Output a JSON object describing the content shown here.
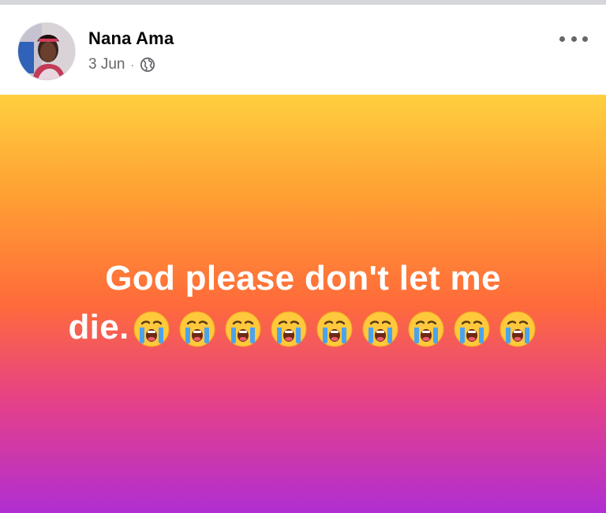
{
  "post": {
    "author": "Nana Ama",
    "date": "3 Jun",
    "separator": "·",
    "audience_icon": "globe-icon",
    "more_icon": "more-options-icon",
    "status_line_1": "God please don't let me",
    "status_line_2_text": "die.",
    "status_emojis": [
      "loudly-crying-face",
      "loudly-crying-face",
      "loudly-crying-face",
      "loudly-crying-face",
      "loudly-crying-face",
      "loudly-crying-face",
      "loudly-crying-face",
      "loudly-crying-face",
      "loudly-crying-face"
    ],
    "background_gradient": [
      "#ffcf3f",
      "#ff6b3a",
      "#b02ed2"
    ],
    "text_color": "#ffffff",
    "name_color": "#050505",
    "meta_color": "#65676b"
  }
}
